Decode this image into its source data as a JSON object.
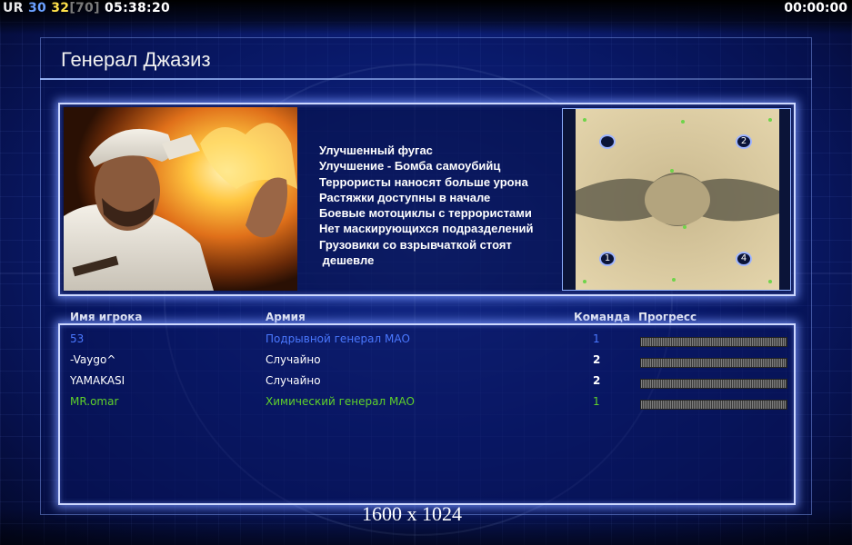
{
  "hud": {
    "ur": "UR",
    "n30": "30",
    "n32": "32",
    "n70": "[70]",
    "clock": "05:38:20",
    "timer": "00:00:00"
  },
  "title": "Генерал Джазиз",
  "bonuses": [
    "Улучшенный фугас",
    "Улучшение - Бомба самоубийц",
    "Террористы наносят больше урона",
    "Растяжки доступны в начале",
    "Боевые мотоциклы с террористами",
    "Нет маскирующихся подразделений",
    "Грузовики со взрывчаткой стоят",
    " дешевле"
  ],
  "map": {
    "start_positions": [
      "",
      "2",
      "1",
      "4"
    ]
  },
  "table": {
    "headers": {
      "name": "Имя игрока",
      "army": "Армия",
      "team": "Команда",
      "progress": "Прогресс"
    },
    "players": [
      {
        "name": "53",
        "army": "Подрывной генерал МАО",
        "team": "1",
        "color": "#4a78ff"
      },
      {
        "name": "-Vaygo^",
        "army": "Случайно",
        "team": "2",
        "color": "#ffffff"
      },
      {
        "name": "YAMAKASI",
        "army": "Случайно",
        "team": "2",
        "color": "#ffffff"
      },
      {
        "name": "MR.omar",
        "army": "Химический генерал МАО",
        "team": "1",
        "color": "#5fd12a"
      }
    ]
  },
  "resolution": "1600 x 1024",
  "colors": {
    "accent": "#cdd8ff",
    "background": "#0c1f7a"
  }
}
